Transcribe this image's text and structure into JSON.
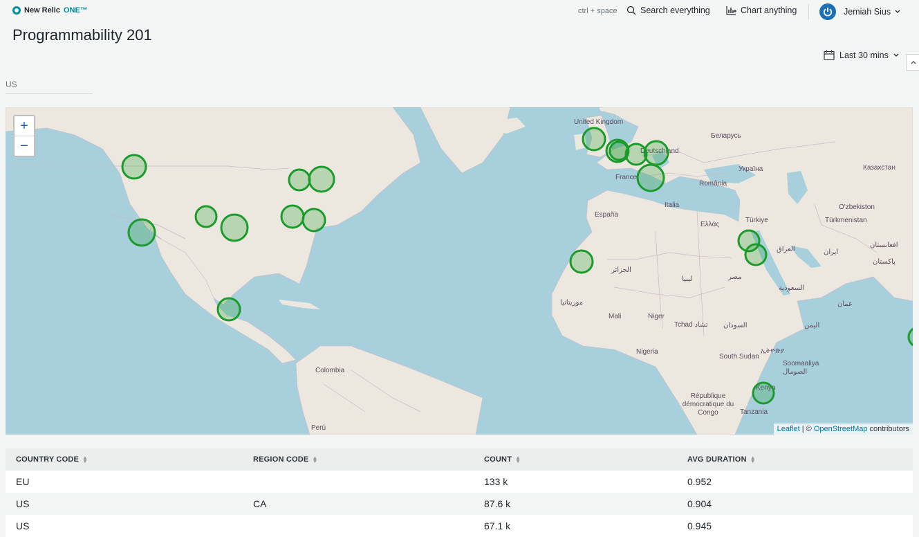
{
  "app": {
    "logo_text": "New Relic",
    "logo_one": "ONE™",
    "shortcut": "ctrl + space",
    "search_label": "Search everything",
    "chart_label": "Chart anything",
    "user_name": "Jemiah Sius",
    "accent": "#008c99"
  },
  "page": {
    "title": "Programmability 201",
    "time_range": "Last 30 mins",
    "filter_placeholder": "US"
  },
  "map": {
    "zoom_in": "+",
    "zoom_out": "−",
    "attribution_leaflet": "Leaflet",
    "attribution_sep": " | © ",
    "attribution_osm": "OpenStreetMap",
    "attribution_tail": " contributors",
    "marker_color": "#1a9b2b",
    "labels": [
      "United Kingdom",
      "Беларусь",
      "Deutschland",
      "Україна",
      "Казахстан",
      "France",
      "România",
      "Italia",
      "España",
      "Ελλάς",
      "Türkiye",
      "O'zbekiston",
      "Türkmenistan",
      "العراق",
      "ایران",
      "افغانستان",
      "پاکستان",
      "الجزائر",
      "ليبيا",
      "مصر",
      "السعودية",
      "عمان",
      "موريتانيا",
      "Mali",
      "Niger",
      "Tchad تشاد",
      "السودان",
      "اليمن",
      "Nigeria",
      "South Sudan",
      "ኢትዮጵያ",
      "Soomaaliya الصومال",
      "Colombia",
      "Kenya",
      "République démocratique du Congo",
      "Tanzania",
      "Perú"
    ]
  },
  "table": {
    "headers": [
      "COUNTRY CODE",
      "REGION CODE",
      "COUNT",
      "AVG DURATION"
    ],
    "rows": [
      [
        "EU",
        "",
        "133 k",
        "0.952"
      ],
      [
        "US",
        "CA",
        "87.6 k",
        "0.904"
      ],
      [
        "US",
        "",
        "67.1 k",
        "0.945"
      ]
    ]
  }
}
